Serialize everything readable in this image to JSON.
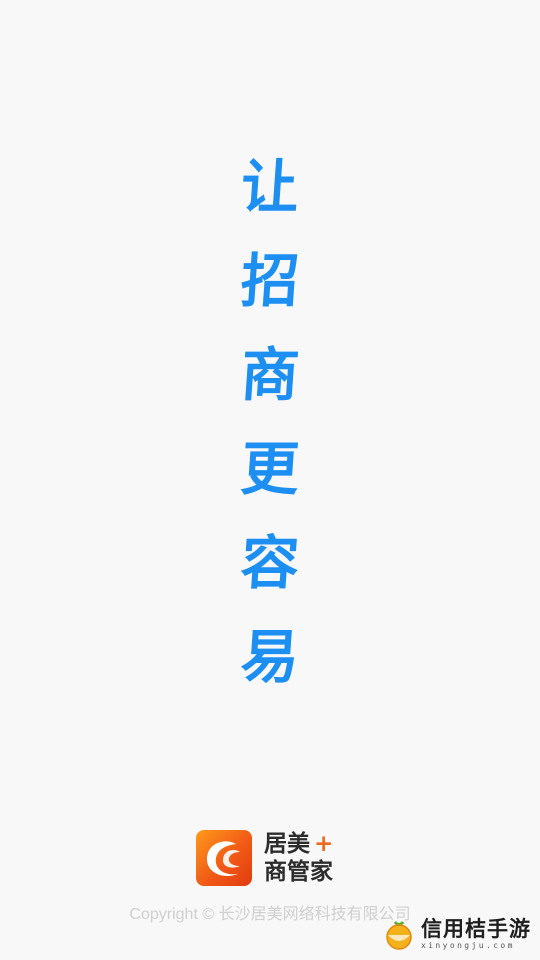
{
  "slogan": {
    "chars": [
      "让",
      "招",
      "商",
      "更",
      "容",
      "易"
    ],
    "color": "#1d8ff2"
  },
  "brand": {
    "logo_icon": "c-swoosh-logo-icon",
    "name_line1": "居美",
    "plus": "+",
    "name_line2": "商管家",
    "accent_color": "#f15a16"
  },
  "copyright": "Copyright © 长沙居美网络科技有限公司",
  "watermark": {
    "icon": "orange-cup-icon",
    "title": "信用桔手游",
    "subtitle": "xinyongju.com"
  }
}
